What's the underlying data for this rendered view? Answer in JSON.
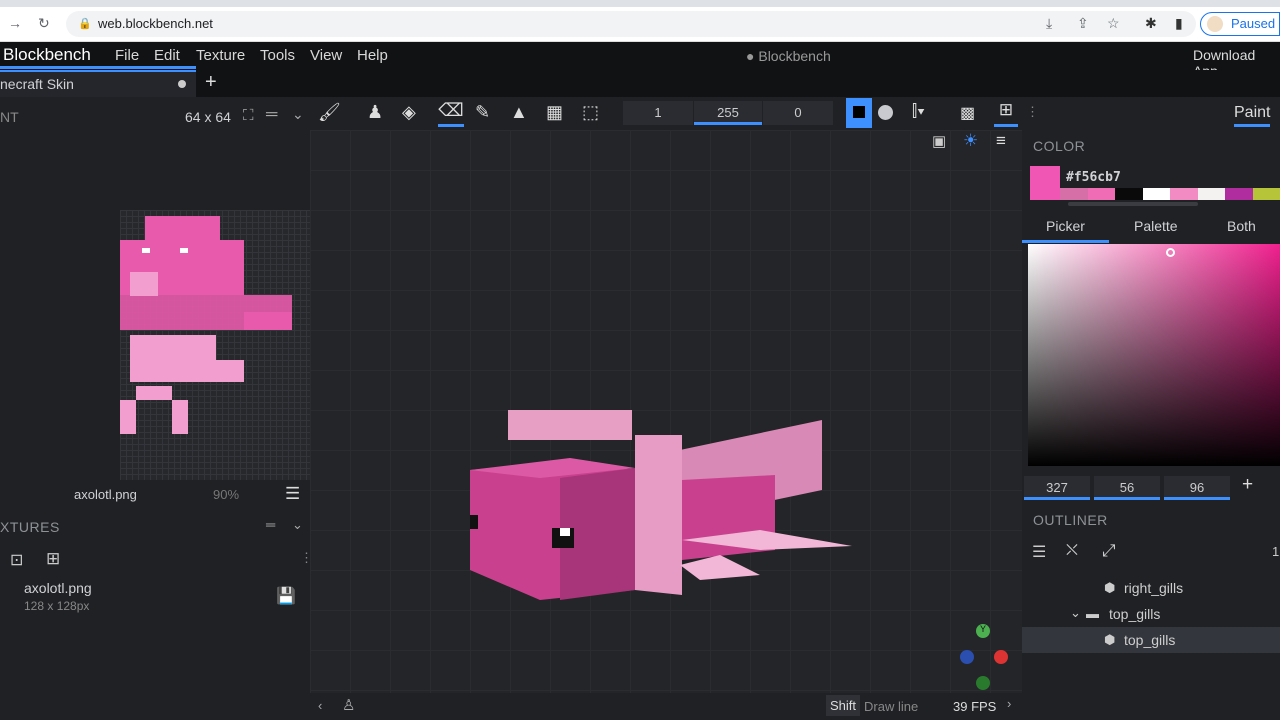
{
  "browser": {
    "url": "web.blockbench.net",
    "profile_status": "Paused"
  },
  "menu": {
    "app": "Blockbench",
    "items": [
      "File",
      "Edit",
      "Texture",
      "Tools",
      "View",
      "Help"
    ],
    "title": "Blockbench",
    "download": "Download App"
  },
  "project_tab": {
    "label": "necraft Skin",
    "add": "+"
  },
  "toolbar": {
    "panel_label": "NT",
    "size": "64 x 64",
    "brush_size": "1",
    "opacity": "255",
    "softness": "0",
    "mode": "Paint"
  },
  "uv": {
    "texture": "axolotl.png",
    "zoom": "90%"
  },
  "textures": {
    "header": "XTURES",
    "items": [
      {
        "name": "axolotl.png",
        "size": "128 x 128px"
      }
    ]
  },
  "color": {
    "header": "COLOR",
    "hex": "#f56cb7",
    "tabs": [
      "Picker",
      "Palette",
      "Both"
    ],
    "h": "327",
    "s": "56",
    "v": "96",
    "add": "+",
    "swatches": [
      "#d66fa8",
      "#f06cb5",
      "#0a0a0a",
      "#ffffff",
      "#f28ac4",
      "#f4f1f1",
      "#b02da0",
      "#b6c43a"
    ]
  },
  "outliner": {
    "header": "OUTLINER",
    "count": "1",
    "items": [
      {
        "name": "right_gills",
        "type": "cube"
      },
      {
        "name": "top_gills",
        "type": "group"
      },
      {
        "name": "top_gills",
        "type": "cube",
        "selected": true
      }
    ]
  },
  "status": {
    "key": "Shift",
    "hint": "Draw line",
    "fps": "39 FPS"
  }
}
